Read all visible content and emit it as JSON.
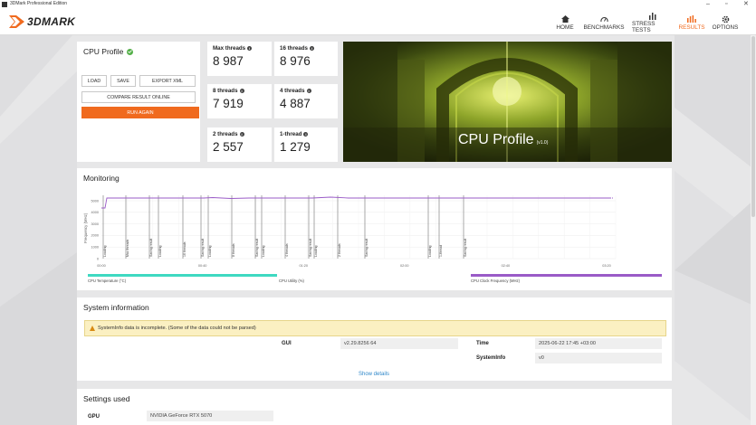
{
  "window": {
    "title": "3DMark Professional Edition"
  },
  "app": {
    "logo": "3DMARK"
  },
  "nav": [
    {
      "label": "HOME",
      "icon": "home-icon"
    },
    {
      "label": "BENCHMARKS",
      "icon": "benchmarks-icon"
    },
    {
      "label": "STRESS TESTS",
      "icon": "stress-tests-icon"
    },
    {
      "label": "RESULTS",
      "icon": "results-icon",
      "active": true
    },
    {
      "label": "OPTIONS",
      "icon": "gear-icon"
    }
  ],
  "profile": {
    "title": "CPU Profile",
    "buttons": {
      "load": "LOAD",
      "save": "SAVE",
      "export": "EXPORT XML",
      "compare": "COMPARE RESULT ONLINE",
      "run": "RUN AGAIN"
    }
  },
  "scores": [
    {
      "label": "Max threads",
      "value": "8 987"
    },
    {
      "label": "16 threads",
      "value": "8 976"
    },
    {
      "label": "8 threads",
      "value": "7 919"
    },
    {
      "label": "4 threads",
      "value": "4 887"
    },
    {
      "label": "2 threads",
      "value": "2 557"
    },
    {
      "label": "1-thread",
      "value": "1 279"
    }
  ],
  "hero": {
    "title": "CPU Profile",
    "version": "(v1.0)"
  },
  "monitoring": {
    "title": "Monitoring",
    "ylabel": "Frequency (MHz)",
    "y_ticks": [
      "5000",
      "4000",
      "3000",
      "2000",
      "1000",
      "0"
    ],
    "x_ticks": [
      "00:00",
      "00:40",
      "01:20",
      "02:00",
      "02:40",
      "03:20"
    ],
    "markers": [
      "Loading",
      "Max threads",
      "Saving result",
      "Loading",
      "16 threads",
      "Saving result",
      "Loading",
      "8 threads",
      "Saving result",
      "Loading",
      "4 threads",
      "Saving result",
      "Loading",
      "2 threads",
      "Saving result",
      "Loading",
      "1-thread",
      "Saving result"
    ],
    "legend": [
      {
        "label": "CPU Temperature (°C)",
        "color": "#3fd9c1"
      },
      {
        "label": "CPU Utility (%)",
        "color": "#ffffff"
      },
      {
        "label": "CPU Clock Frequency (MHz)",
        "color": "#9a5bc7"
      }
    ],
    "line_color": "#9a5bc7"
  },
  "sysinfo": {
    "title": "System information",
    "warning": "SystemInfo data is incomplete. (Some of the data could not be parsed)",
    "rows": [
      {
        "label": "GUI",
        "value": "v2.29.8256 64"
      },
      {
        "label": "Time",
        "value": "2025-06-22 17:45 +03:00"
      },
      {
        "label": "SystemInfo",
        "value": "v0"
      }
    ],
    "show_details": "Show details"
  },
  "settings": {
    "title": "Settings used",
    "rows": [
      {
        "label": "GPU",
        "value": "NVIDIA GeForce RTX 5070"
      }
    ]
  },
  "colors": {
    "accent": "#f06a1e",
    "check": "#55b04a",
    "link": "#2e87c9"
  }
}
